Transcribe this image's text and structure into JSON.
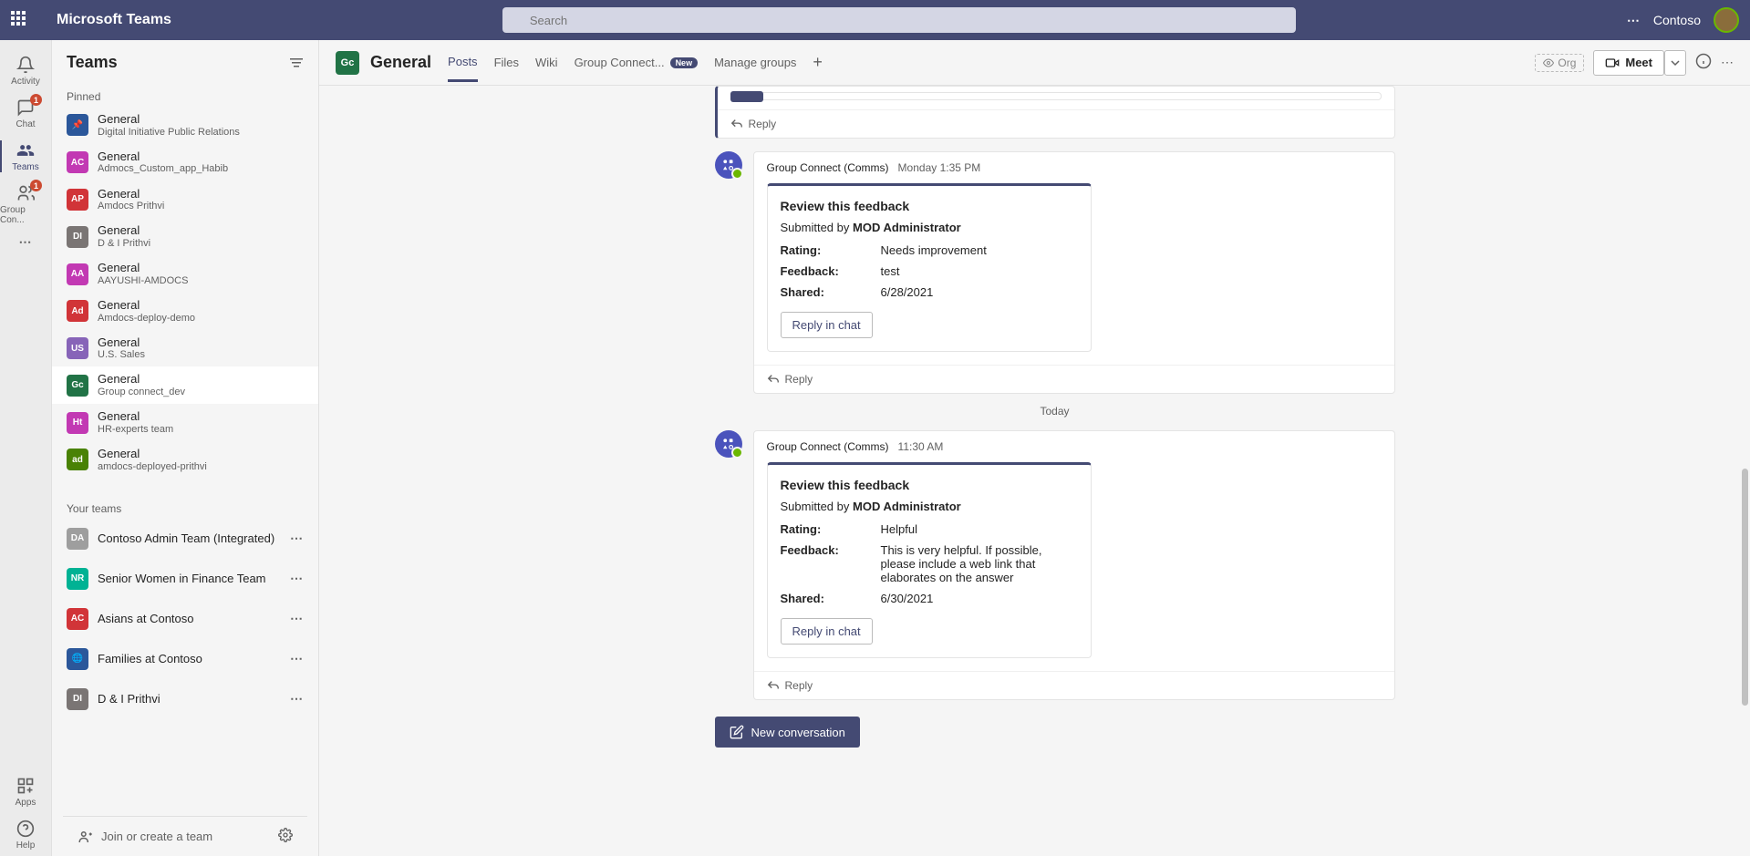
{
  "topbar": {
    "app_title": "Microsoft Teams",
    "search_placeholder": "Search",
    "org_name": "Contoso"
  },
  "rail": [
    {
      "id": "activity",
      "label": "Activity",
      "badge": null
    },
    {
      "id": "chat",
      "label": "Chat",
      "badge": "1"
    },
    {
      "id": "teams",
      "label": "Teams",
      "badge": null,
      "active": true
    },
    {
      "id": "groupcon",
      "label": "Group Con...",
      "badge": "1"
    }
  ],
  "rail_bottom": [
    {
      "id": "apps",
      "label": "Apps"
    },
    {
      "id": "help",
      "label": "Help"
    }
  ],
  "sidebar": {
    "title": "Teams",
    "section_pinned": "Pinned",
    "pinned": [
      {
        "name": "General",
        "sub": "Digital Initiative Public Relations",
        "color": "#2b579a",
        "initials": "📌"
      },
      {
        "name": "General",
        "sub": "Admocs_Custom_app_Habib",
        "color": "#c239b3",
        "initials": "AC"
      },
      {
        "name": "General",
        "sub": "Amdocs Prithvi",
        "color": "#d13438",
        "initials": "AP"
      },
      {
        "name": "General",
        "sub": "D & I Prithvi",
        "color": "#7a7574",
        "initials": "DI"
      },
      {
        "name": "General",
        "sub": "AAYUSHI-AMDOCS",
        "color": "#c239b3",
        "initials": "AA"
      },
      {
        "name": "General",
        "sub": "Amdocs-deploy-demo",
        "color": "#d13438",
        "initials": "Ad"
      },
      {
        "name": "General",
        "sub": "U.S. Sales",
        "color": "#8764b8",
        "initials": "US"
      },
      {
        "name": "General",
        "sub": "Group connect_dev",
        "color": "#217346",
        "initials": "Gc",
        "selected": true
      },
      {
        "name": "General",
        "sub": "HR-experts team",
        "color": "#c239b3",
        "initials": "Ht"
      },
      {
        "name": "General",
        "sub": "amdocs-deployed-prithvi",
        "color": "#498205",
        "initials": "ad"
      }
    ],
    "section_yourteams": "Your teams",
    "teams": [
      {
        "name": "Contoso Admin Team (Integrated)",
        "color": "#9e9e9e",
        "initials": "DA"
      },
      {
        "name": "Senior Women in Finance Team",
        "color": "#00b294",
        "initials": "NR"
      },
      {
        "name": "Asians at Contoso",
        "color": "#d13438",
        "initials": "AC"
      },
      {
        "name": "Families at Contoso",
        "color": "#2b579a",
        "initials": "🌐"
      },
      {
        "name": "D & I Prithvi",
        "color": "#7a7574",
        "initials": "DI"
      }
    ],
    "join_label": "Join or create a team"
  },
  "channel": {
    "initials": "Gc",
    "title": "General",
    "tabs": [
      "Posts",
      "Files",
      "Wiki",
      "Group Connect...",
      "Manage groups"
    ],
    "tab_new_badge": "New",
    "org_label": "Org",
    "meet_label": "Meet"
  },
  "feed": {
    "reply_label": "Reply",
    "reply_chat_label": "Reply in chat",
    "today_label": "Today",
    "new_conv_label": "New conversation",
    "card_title": "Review this feedback",
    "submitted_prefix": "Submitted by ",
    "rating_label": "Rating:",
    "feedback_label": "Feedback:",
    "shared_label": "Shared:",
    "messages": [
      {
        "author": "Group Connect (Comms)",
        "time": "Monday 1:35 PM",
        "submitter": "MOD Administrator",
        "rating": "Needs improvement",
        "feedback": "test",
        "shared": "6/28/2021"
      },
      {
        "author": "Group Connect (Comms)",
        "time": "11:30 AM",
        "submitter": "MOD Administrator",
        "rating": "Helpful",
        "feedback": "This is very helpful. If possible, please include a web link that elaborates on the answer",
        "shared": "6/30/2021"
      }
    ]
  }
}
